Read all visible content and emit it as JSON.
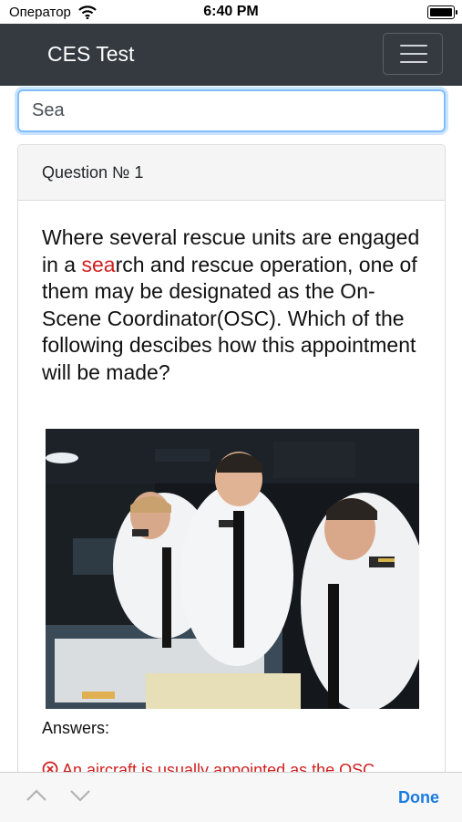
{
  "status": {
    "carrier": "Оператор",
    "time": "6:40 PM"
  },
  "navbar": {
    "title": "CES Test"
  },
  "search": {
    "value": "Sea"
  },
  "question": {
    "header": "Question № 1",
    "text_before": "Where several rescue units are engaged in a ",
    "highlight": "sea",
    "text_after": "rch and rescue operation, one of them may be designated as the On-Scene Coordinator(OSC). Which of the following descibes how this appointment will be made?",
    "image_description": "officers-at-chart-table-photo"
  },
  "answers": {
    "label": "Answers:",
    "items": [
      {
        "text": "An aircraft is usually appointed as the OSC",
        "status": "incorrect"
      }
    ]
  },
  "toolbar": {
    "done_label": "Done"
  },
  "colors": {
    "navbar": "#343a40",
    "highlight": "#d11f1f",
    "focus_border": "#80bdff",
    "done": "#1a7be0"
  }
}
